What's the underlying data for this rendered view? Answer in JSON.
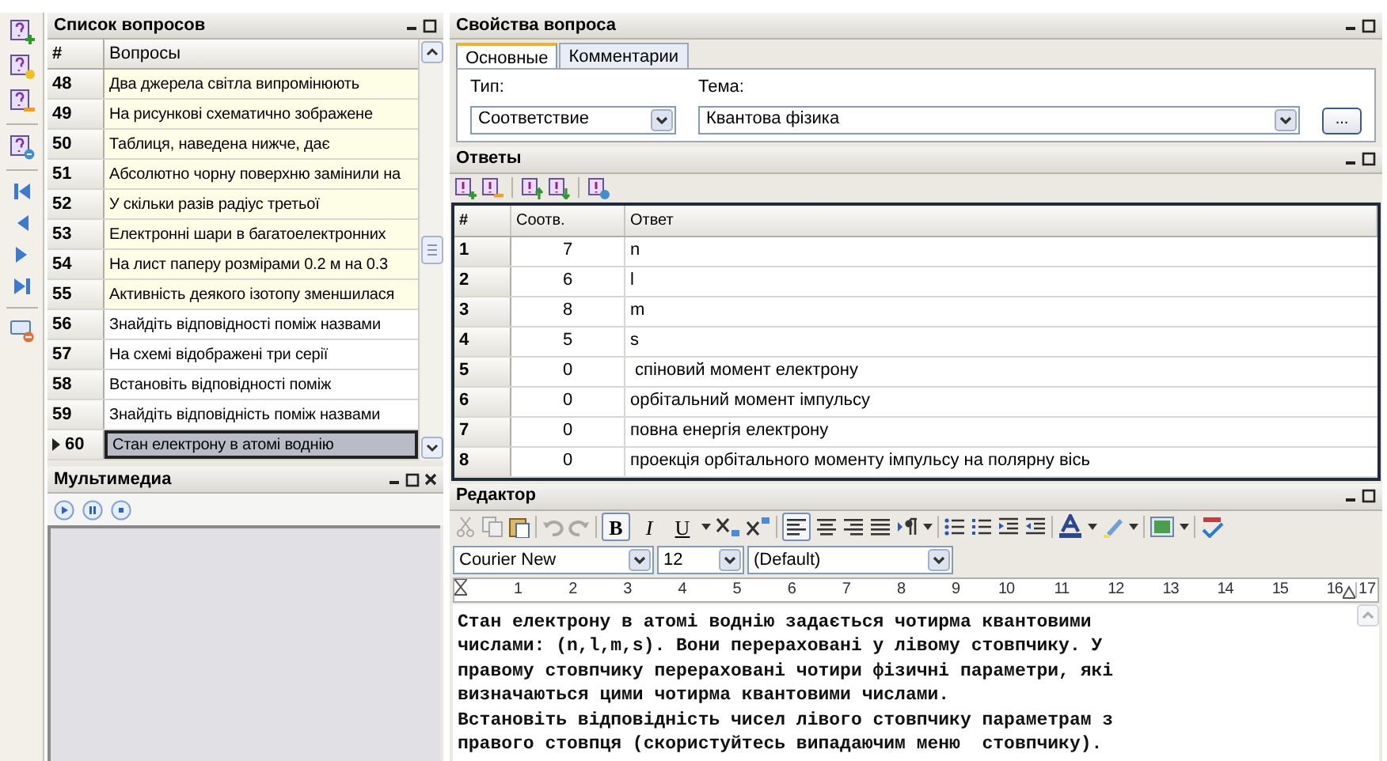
{
  "questions_panel": {
    "title": "Список вопросов",
    "columns": [
      "#",
      "Вопросы"
    ],
    "rows": [
      {
        "number": "48",
        "text": "Два джерела світла випромінюють",
        "highlighted": true,
        "selected": false
      },
      {
        "number": "49",
        "text": "На рисункові схематично зображене",
        "highlighted": true,
        "selected": false
      },
      {
        "number": "50",
        "text": "Таблиця, наведена нижче, дає",
        "highlighted": true,
        "selected": false
      },
      {
        "number": "51",
        "text": "Абсолютно чорну поверхню замінили на",
        "highlighted": true,
        "selected": false
      },
      {
        "number": "52",
        "text": "У скільки разів радіус третьої",
        "highlighted": true,
        "selected": false
      },
      {
        "number": "53",
        "text": "Електронні шари в багатоелектронних",
        "highlighted": true,
        "selected": false
      },
      {
        "number": "54",
        "text": "На лист паперу розмірами 0.2 м на 0.3",
        "highlighted": true,
        "selected": false
      },
      {
        "number": "55",
        "text": "Активність деякого ізотопу зменшилася",
        "highlighted": true,
        "selected": false
      },
      {
        "number": "56",
        "text": "Знайдіть відповідності поміж назвами",
        "highlighted": false,
        "selected": false
      },
      {
        "number": "57",
        "text": "На схемі відображені три серії",
        "highlighted": false,
        "selected": false
      },
      {
        "number": "58",
        "text": "Встановіть відповідності поміж",
        "highlighted": false,
        "selected": false
      },
      {
        "number": "59",
        "text": "Знайдіть відповідність поміж назвами",
        "highlighted": false,
        "selected": false
      },
      {
        "number": "60",
        "text": "Стан електрону в атомі воднію",
        "highlighted": false,
        "selected": true
      }
    ]
  },
  "multimedia_panel": {
    "title": "Мультимедиа"
  },
  "properties_panel": {
    "title": "Свойства вопроса",
    "tabs": [
      {
        "label": "Основные",
        "selected": true
      },
      {
        "label": "Комментарии",
        "selected": false
      }
    ],
    "type_label": "Тип:",
    "type_value": "Соответствие",
    "topic_label": "Тема:",
    "topic_value": "Квантова фізика",
    "browse_button": "..."
  },
  "answers_panel": {
    "title": "Ответы",
    "columns": [
      "#",
      "Соотв.",
      "Ответ"
    ],
    "rows": [
      {
        "number": "1",
        "match": "7",
        "answer": "n"
      },
      {
        "number": "2",
        "match": "6",
        "answer": "l"
      },
      {
        "number": "3",
        "match": "8",
        "answer": "m"
      },
      {
        "number": "4",
        "match": "5",
        "answer": "s"
      },
      {
        "number": "5",
        "match": "0",
        "answer": " спіновий момент електрону"
      },
      {
        "number": "6",
        "match": "0",
        "answer": "орбітальний момент імпульсу"
      },
      {
        "number": "7",
        "match": "0",
        "answer": "повна енергія електрону"
      },
      {
        "number": "8",
        "match": "0",
        "answer": "проекція орбітального моменту імпульсу на полярну вісь"
      }
    ]
  },
  "editor_panel": {
    "title": "Редактор",
    "format_buttons": [
      {
        "label": "B",
        "selected": true
      },
      {
        "label": "I",
        "selected": false
      },
      {
        "label": "U",
        "selected": false
      }
    ],
    "font": "Courier New",
    "size": "12",
    "style": "(Default)",
    "ruler_marks": [
      "1",
      "2",
      "3",
      "4",
      "5",
      "6",
      "7",
      "8",
      "9",
      "10",
      "11",
      "12",
      "13",
      "14",
      "15",
      "16"
    ],
    "ruler_end": "17",
    "lines": [
      "Стан електрону в атомі воднію задається чотирма квантовими",
      "числами: (n,l,m,s). Вони перераховані у лівому стовпчику. У",
      "правому стовпчику перераховані чотири фізичні параметри, які",
      "визначаються цими чотирма квантовими числами.",
      "Встановіть відповідність чисел лівого стовпчику параметрам з",
      "правого стовпця (скористуйтесь випадаючим меню  стовпчику)."
    ]
  }
}
